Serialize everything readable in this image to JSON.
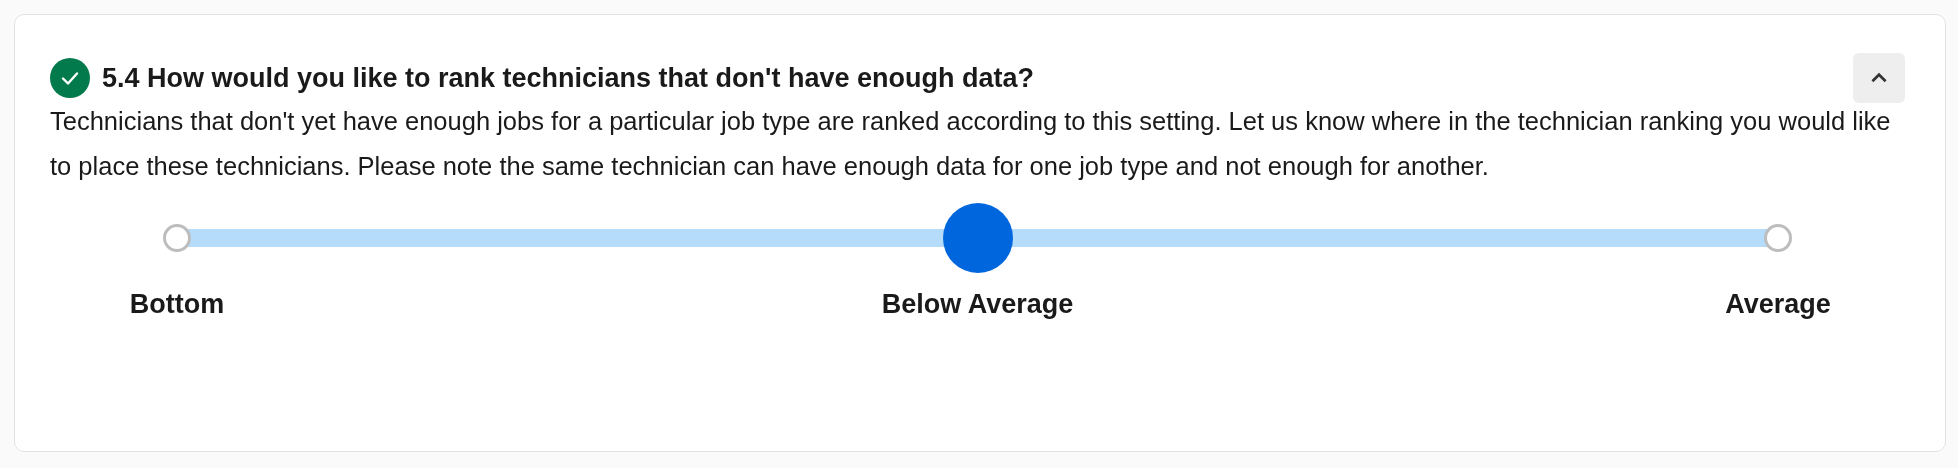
{
  "question": {
    "completed": true,
    "expanded": true,
    "title": "5.4 How would you like to rank technicians that don't have enough data?",
    "description": "Technicians that don't yet have enough jobs for a particular job type are ranked according to this setting. Let us know where in the technician ranking you would like to place these technicians. Please note the same technician can have enough data for one job type and not enough for another.",
    "options": [
      {
        "label": "Bottom",
        "selected": false
      },
      {
        "label": "Below Average",
        "selected": true
      },
      {
        "label": "Average",
        "selected": false
      }
    ]
  }
}
